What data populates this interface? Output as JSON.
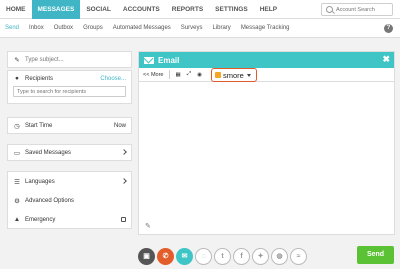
{
  "topnav": {
    "items": [
      "HOME",
      "MESSAGES",
      "SOCIAL",
      "ACCOUNTS",
      "REPORTS",
      "SETTINGS",
      "HELP"
    ],
    "active_index": 1,
    "account_search_placeholder": "Account Search"
  },
  "subnav": {
    "items": [
      "Send",
      "Inbox",
      "Outbox",
      "Groups",
      "Automated Messages",
      "Surveys",
      "Library",
      "Message Tracking"
    ],
    "active_index": 0,
    "help_label": "?"
  },
  "left": {
    "subject_placeholder": "Type subject...",
    "recipients_label": "Recipients",
    "choose_label": "Choose...",
    "recipients_placeholder": "Type to search for recipients",
    "start_time_label": "Start Time",
    "start_time_value": "Now",
    "saved_messages_label": "Saved Messages",
    "languages_label": "Languages",
    "advanced_options_label": "Advanced Options",
    "emergency_label": "Emergency"
  },
  "email": {
    "title": "Email",
    "close_label": "✖",
    "more_label": "<< More",
    "smore_label": "smore"
  },
  "channels": [
    "channel-sms",
    "channel-voice",
    "channel-email",
    "channel-chat",
    "channel-tumblr",
    "channel-facebook",
    "channel-twitter",
    "channel-web",
    "channel-rss"
  ],
  "send_label": "Send"
}
